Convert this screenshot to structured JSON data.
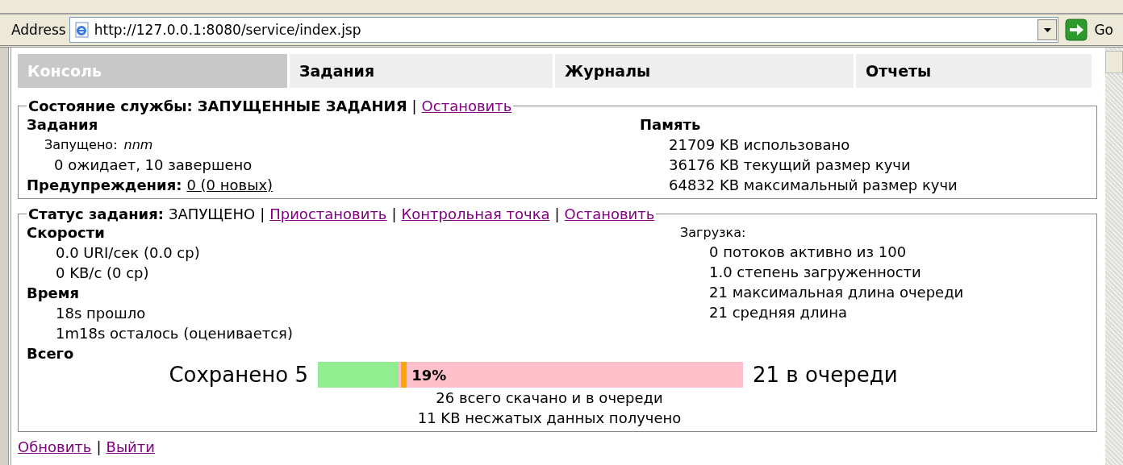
{
  "address_bar": {
    "label": "Address",
    "url": "http://127.0.0.1:8080/service/index.jsp",
    "go": "Go"
  },
  "tabs": [
    {
      "label": "Консоль",
      "selected": true
    },
    {
      "label": "Задания",
      "selected": false
    },
    {
      "label": "Журналы",
      "selected": false
    },
    {
      "label": "Отчеты",
      "selected": false
    }
  ],
  "service_status": {
    "title": "Состояние службы:",
    "value": "ЗАПУЩЕННЫЕ ЗАДАНИЯ",
    "separator": "|",
    "actions": [
      "Остановить"
    ],
    "jobs": {
      "heading": "Задания",
      "launched_label": "Запущено:",
      "launched_value": "nnm",
      "counts": "0 ожидает, 10 завершено",
      "alerts_label": "Предупреждения:",
      "alerts_link": "0 (0 новых)"
    },
    "memory": {
      "heading": "Память",
      "lines": [
        "21709 KB использовано",
        "36176 KB текущий размер кучи",
        "64832 KB максимальный размер кучи"
      ]
    }
  },
  "job_status": {
    "title": "Статус задания:",
    "value": "ЗАПУЩЕНО",
    "separator": "|",
    "actions": [
      "Приостановить",
      "Контрольная точка",
      "Остановить"
    ],
    "sections": [
      {
        "heading": "Скорости",
        "lines": [
          "0.0 URI/сек (0.0 ср)",
          "0 KB/с (0 ср)"
        ]
      },
      {
        "heading": "Время",
        "lines": [
          "18s прошло",
          "1m18s осталось (оценивается)"
        ]
      },
      {
        "heading": "Всего"
      }
    ],
    "load": {
      "heading": "Загрузка:",
      "lines": [
        "0 потоков активно из 100",
        "1.0 степень загруженности",
        "21 максимальная длина очереди",
        "21 средняя длина"
      ]
    },
    "progress": {
      "saved": "Сохранено 5",
      "level": 0.19,
      "percent": "19%",
      "queued": "21 в очереди"
    },
    "summary": [
      "26 всего скачано и в очереди",
      "11 KB несжатых данных получено"
    ]
  },
  "footer": {
    "separator": "|",
    "links": [
      "Обновить",
      "Выйти"
    ]
  }
}
